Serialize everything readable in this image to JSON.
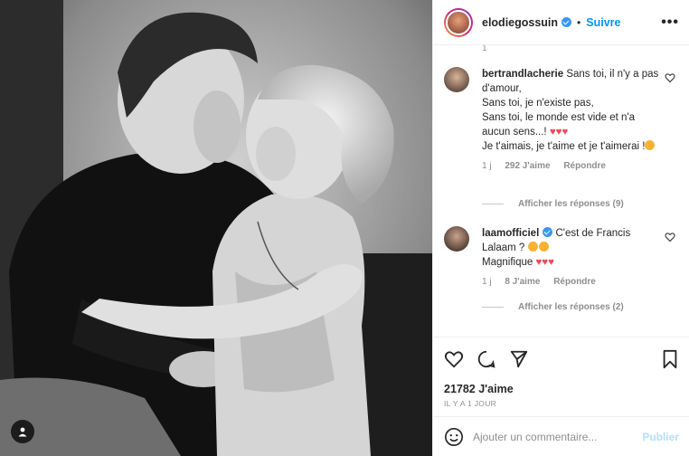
{
  "post": {
    "username": "elodiegossuin",
    "follow_label": "Suivre",
    "more_label": "•••",
    "separator": "•",
    "stray_count": "1"
  },
  "comments": [
    {
      "username": "bertrandlacherie",
      "text_first": "Sans toi, il n'y a pas d'amour,",
      "lines": [
        "Sans toi, je n'existe pas,",
        "Sans toi, le monde est vide et n'a aucun sens...!",
        "Je t'aimais, je t'aime et je t'aimerai !"
      ],
      "time": "1 j",
      "likes": "292 J'aime",
      "reply": "Répondre",
      "show_replies": "Afficher les réponses (9)"
    },
    {
      "username": "laamofficiel",
      "text_first": "C'est de Francis Lalaam ?",
      "lines": [
        "Magnifique"
      ],
      "time": "1 j",
      "likes": "8 J'aime",
      "reply": "Répondre",
      "show_replies": "Afficher les réponses (2)"
    }
  ],
  "footer": {
    "likes": "21782 J'aime",
    "time_ago": "IL Y A 1 JOUR",
    "comment_placeholder": "Ajouter un commentaire...",
    "publish": "Publier"
  },
  "colors": {
    "accent": "#0095f6",
    "heart_emoji": "#ed4956",
    "muted": "#8e8e8e"
  },
  "icons": [
    "user-tag-icon",
    "more-icon",
    "heart-icon",
    "comment-icon",
    "share-icon",
    "save-icon",
    "emoji-icon"
  ]
}
